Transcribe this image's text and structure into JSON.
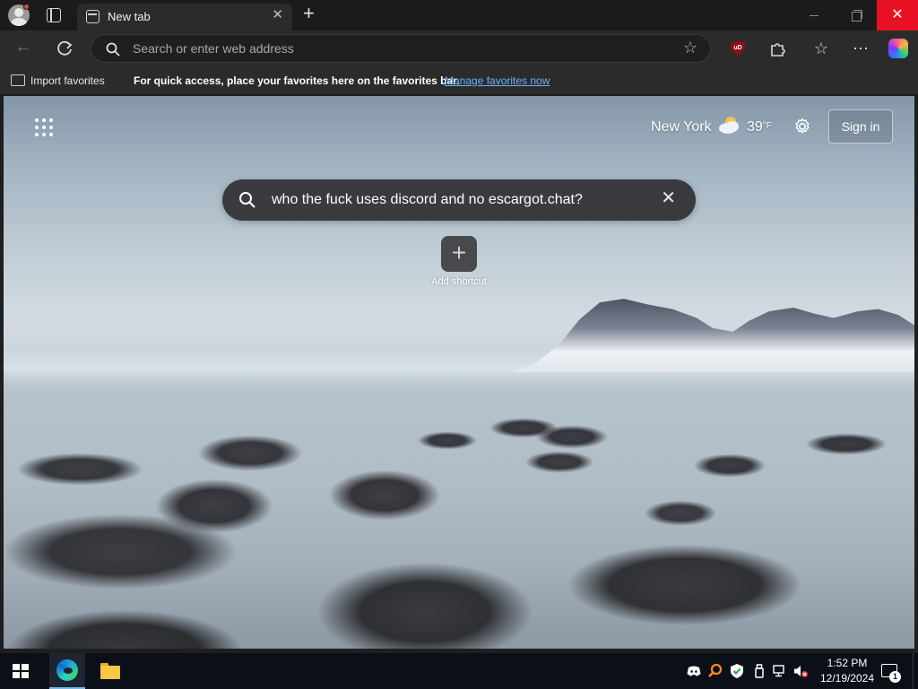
{
  "browser": {
    "tab": {
      "title": "New tab"
    },
    "address_bar": {
      "placeholder": "Search or enter web address"
    },
    "extensions": {
      "ublock_label": "uD"
    }
  },
  "favorites_bar": {
    "import_label": "Import favorites",
    "message": "For quick access, place your favorites here on the favorites bar.",
    "manage_link": "Manage favorites now"
  },
  "new_tab_page": {
    "weather": {
      "city": "New York",
      "temperature": "39",
      "unit": "°F"
    },
    "sign_in_label": "Sign in",
    "search": {
      "value": "who the fuck uses discord and no escargot.chat?"
    },
    "shortcut": {
      "add_label": "Add shortcut"
    }
  },
  "taskbar": {
    "clock": {
      "time": "1:52 PM",
      "date": "12/19/2024"
    },
    "notification_count": "1"
  },
  "icons": {
    "titlebar": [
      "profile-avatar-icon",
      "tab-actions-icon",
      "new-tab-page-icon",
      "close-icon",
      "plus-icon",
      "minimize-icon",
      "restore-icon",
      "close-icon"
    ],
    "toolbar": [
      "back-arrow-icon",
      "refresh-icon",
      "search-icon",
      "favorite-star-icon",
      "ublock-origin-icon",
      "extensions-icon",
      "favorites-icon",
      "more-icon",
      "copilot-icon"
    ],
    "tray": [
      "discord-icon",
      "search-everything-icon",
      "windows-security-icon",
      "usb-icon",
      "network-icon",
      "volume-muted-icon",
      "notification-icon"
    ]
  },
  "colors": {
    "close_button": "#e81123",
    "link": "#6fb0ff",
    "taskbar": "#0b0f18",
    "active_app_underline": "#76b9ed"
  }
}
